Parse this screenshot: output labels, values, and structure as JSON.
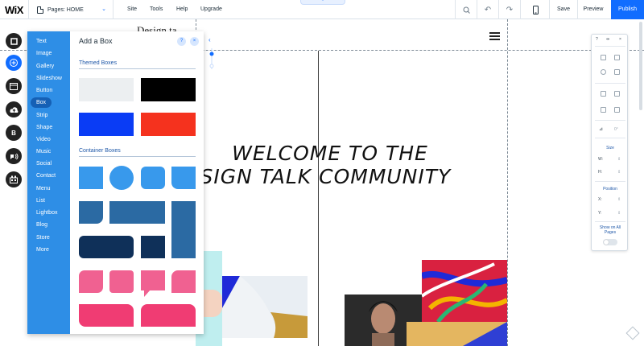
{
  "topbar": {
    "logo": "WiX",
    "pages_label": "Pages: HOME",
    "menu": [
      "Site",
      "Tools",
      "Help",
      "Upgrade"
    ],
    "icons": [
      "zoom-icon",
      "undo-icon",
      "redo-icon",
      "mobile-view-icon"
    ],
    "save": "Save",
    "preview": "Preview",
    "publish": "Publish",
    "accent": "#116dff"
  },
  "rail": {
    "buttons": [
      "pages-icon",
      "add-icon",
      "background-icon",
      "upload-icon",
      "blog-icon",
      "social-icon",
      "app-market-icon"
    ],
    "blog_letter": "B"
  },
  "panel": {
    "title": "Add a Box",
    "help": "?",
    "close": "×",
    "categories": [
      "Text",
      "Image",
      "Gallery",
      "Slideshow",
      "Button",
      "Box",
      "Strip",
      "Shape",
      "Video",
      "Music",
      "Social",
      "Contact",
      "Menu",
      "List",
      "Lightbox",
      "Blog",
      "Store",
      "More"
    ],
    "selected_category": "Box",
    "themed_label": "Themed Boxes",
    "container_label": "Container Boxes",
    "themed_colors": [
      "#eceff1",
      "#000000",
      "#0a3cf5",
      "#f5321e"
    ],
    "container_colors": [
      "#3899ec",
      "#2b6aa3",
      "#0f3059",
      "#f06191",
      "#f03c73"
    ]
  },
  "site": {
    "logo_partial": "Design ta",
    "headline_1": "WELCOME  TO  THE",
    "headline_2": "ESIGN TALK COMMUNITY"
  },
  "inspector": {
    "top_icons": [
      "?",
      "⇹",
      "×"
    ],
    "size_label": "Size",
    "w_label": "W:",
    "h_label": "H:",
    "position_label": "Position",
    "x_label": "X:",
    "y_label": "Y:",
    "show_all_label": "Show on All Pages",
    "rotation": "0°"
  }
}
